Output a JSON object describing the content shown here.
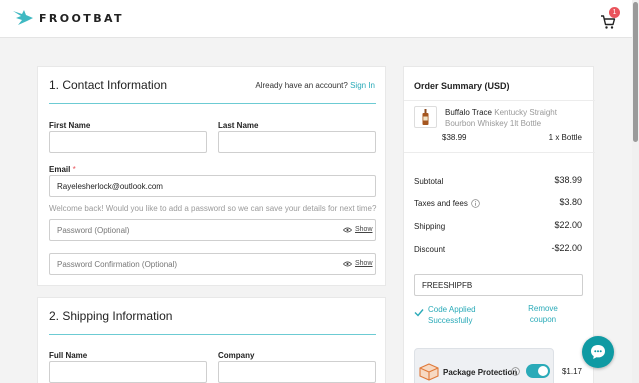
{
  "brand": {
    "name": "FROOTBAT"
  },
  "cart": {
    "count": "1"
  },
  "contact": {
    "title": "1. Contact Information",
    "signin_prompt": "Already have an account?",
    "signin_link": "Sign In",
    "first_name_label": "First Name",
    "first_name_value": "",
    "last_name_label": "Last Name",
    "last_name_value": "",
    "email_label": "Email",
    "email_required": "*",
    "email_value": "Rayelesherlock@outlook.com",
    "welcome_hint": "Welcome back! Would you like to add a password so we can save your details for next time?",
    "password_placeholder": "Password (Optional)",
    "password_confirm_placeholder": "Password Confirmation (Optional)",
    "show_label": "Show"
  },
  "shipping": {
    "title": "2. Shipping Information",
    "full_name_label": "Full Name",
    "company_label": "Company"
  },
  "summary": {
    "title": "Order Summary (USD)",
    "product": {
      "name": "Buffalo Trace",
      "variant": "Kentucky Straight Bourbon Whiskey 1lt Bottle",
      "price": "$38.99",
      "quantity": "1 x Bottle"
    },
    "subtotal_label": "Subtotal",
    "subtotal_value": "$38.99",
    "taxes_label": "Taxes and fees",
    "taxes_value": "$3.80",
    "shipping_label": "Shipping",
    "shipping_value": "$22.00",
    "discount_label": "Discount",
    "discount_value": "-$22.00",
    "code_value": "FREESHIPFB",
    "code_status": "Code Applied Successfully",
    "remove_coupon": "Remove coupon",
    "protection_label": "Package Protection",
    "protection_enabled": true,
    "protection_price": "$1.17"
  },
  "colors": {
    "accent": "#2aaab8",
    "badge": "#e9545c",
    "chat": "#0f9aa3"
  },
  "icons": [
    "frootbat-logo-icon",
    "cart-icon",
    "eye-icon",
    "info-icon",
    "check-icon",
    "box-icon",
    "chat-icon"
  ]
}
